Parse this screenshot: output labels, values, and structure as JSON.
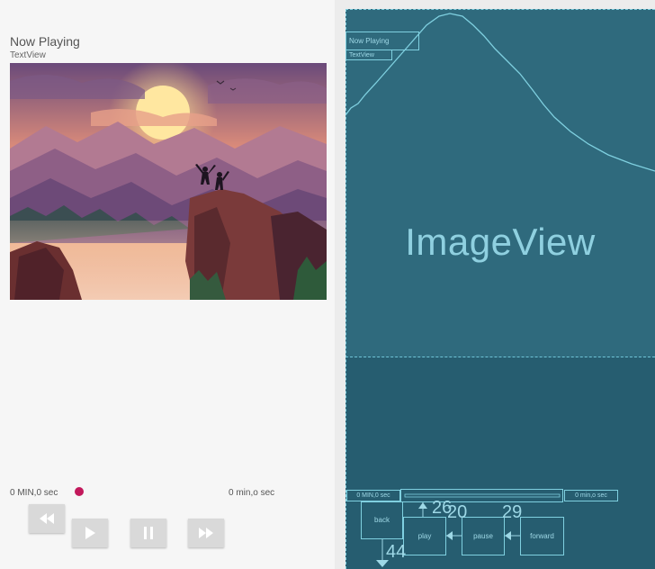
{
  "design": {
    "title": "Now Playing",
    "subtitle": "TextView",
    "elapsed": "0 MIN,0 sec",
    "duration": "0 min,o sec",
    "accent_color": "#c2185b",
    "controls": {
      "back_icon": "rewind-icon",
      "play_icon": "play-icon",
      "pause_icon": "pause-icon",
      "forward_icon": "fast-forward-icon"
    }
  },
  "blueprint": {
    "image_label": "ImageView",
    "title_box": "Now Playing",
    "subtitle_box": "TextView",
    "elapsed_box": "0 MIN,0 sec",
    "duration_box": "0 min,o sec",
    "back_label": "back",
    "play_label": "play",
    "pause_label": "pause",
    "forward_label": "forward",
    "margin_26": "26",
    "margin_20": "20",
    "margin_29": "29",
    "margin_44": "44"
  }
}
